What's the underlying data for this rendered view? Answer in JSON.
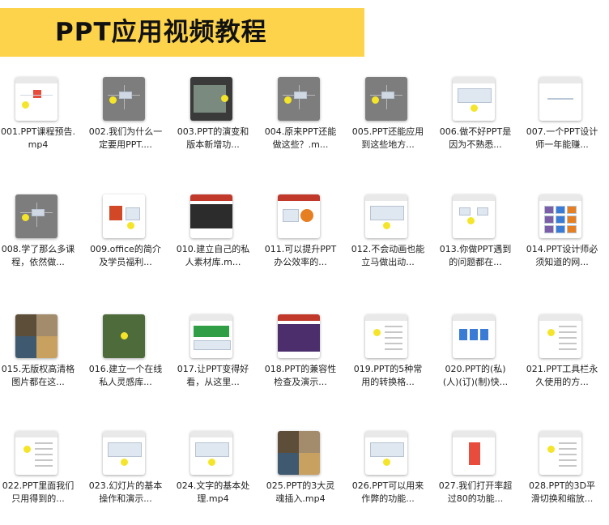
{
  "header": {
    "title": "PPT应用视频教程",
    "banner_color": "#fcd34a"
  },
  "items": [
    {
      "label": "001.PPT课程预告.mp4",
      "thumb": "white-mindmap"
    },
    {
      "label": "002.我们为什么一定要用PPT....",
      "thumb": "gray-diagram"
    },
    {
      "label": "003.PPT的演变和版本新增功...",
      "thumb": "dark-video"
    },
    {
      "label": "004.原来PPT还能做这些？.m...",
      "thumb": "gray-diagram"
    },
    {
      "label": "005.PPT还能应用到这些地方...",
      "thumb": "gray-diagram"
    },
    {
      "label": "006.做不好PPT是因为不熟悉...",
      "thumb": "white-slide"
    },
    {
      "label": "007.一个PPT设计师一年能赚...",
      "thumb": "white-blank"
    },
    {
      "label": "008.学了那么多课程，依然做...",
      "thumb": "gray-diagram"
    },
    {
      "label": "009.office的简介及学员福利...",
      "thumb": "white-ppt-logo"
    },
    {
      "label": "010.建立自己的私人素材库.m...",
      "thumb": "dark-slide"
    },
    {
      "label": "011.可以提升PPT办公效率的...",
      "thumb": "white-chart"
    },
    {
      "label": "012.不会动画也能立马做出动...",
      "thumb": "white-slide"
    },
    {
      "label": "013.你做PPT遇到的问题都在...",
      "thumb": "white-diagram"
    },
    {
      "label": "014.PPT设计师必须知道的网...",
      "thumb": "white-grid"
    },
    {
      "label": "015.无版权高清格图片都在这...",
      "thumb": "photo-collage"
    },
    {
      "label": "016.建立一个在线私人灵感库...",
      "thumb": "green"
    },
    {
      "label": "017.让PPT变得好看，从这里...",
      "thumb": "white-green"
    },
    {
      "label": "018.PPT的兼容性检查及演示...",
      "thumb": "purple"
    },
    {
      "label": "019.PPT的5种常用的转换格...",
      "thumb": "white-list"
    },
    {
      "label": "020.PPT的(私)(人)(订)(制)快...",
      "thumb": "white-blue"
    },
    {
      "label": "021.PPT工具栏永久使用的方...",
      "thumb": "white-list"
    },
    {
      "label": "022.PPT里面我们只用得到的...",
      "thumb": "white-list"
    },
    {
      "label": "023.幻灯片的基本操作和演示...",
      "thumb": "white-slide"
    },
    {
      "label": "024.文字的基本处理.mp4",
      "thumb": "white-slide"
    },
    {
      "label": "025.PPT的3大灵魂插入.mp4",
      "thumb": "photo-collage"
    },
    {
      "label": "026.PPT可以用来作弊的功能...",
      "thumb": "white-slide"
    },
    {
      "label": "027.我们打开率超过80的功能...",
      "thumb": "white-red"
    },
    {
      "label": "028.PPT的3D平滑切换和缩放...",
      "thumb": "white-list"
    }
  ]
}
